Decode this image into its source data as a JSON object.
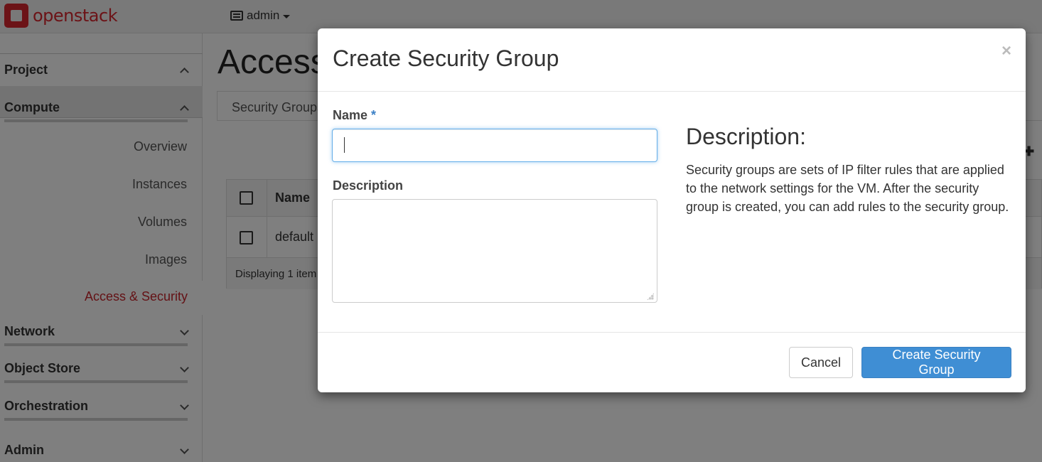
{
  "navbar": {
    "brand": "openstack",
    "project": "admin"
  },
  "sidebar": {
    "project": "Project",
    "compute": "Compute",
    "compute_items": [
      "Overview",
      "Instances",
      "Volumes",
      "Images"
    ],
    "active_item": "Access & Security",
    "sections": [
      "Network",
      "Object Store",
      "Orchestration",
      "Admin"
    ]
  },
  "main": {
    "title": "Access",
    "tab": "Security Groups",
    "table": {
      "header": "Name",
      "rows": [
        "default"
      ],
      "footer": "Displaying 1 item"
    }
  },
  "modal": {
    "title": "Create Security Group",
    "close": "×",
    "name_label": "Name",
    "required_mark": "*",
    "name_value": "",
    "description_label": "Description",
    "description_value": "",
    "help_title": "Description:",
    "help_text": "Security groups are sets of IP filter rules that are applied to the network settings for the VM. After the security group is created, you can add rules to the security group.",
    "cancel": "Cancel",
    "submit": "Create Security Group"
  },
  "colors": {
    "brand": "#d9262e",
    "active": "#c9252c",
    "primary": "#3f8ed4"
  }
}
